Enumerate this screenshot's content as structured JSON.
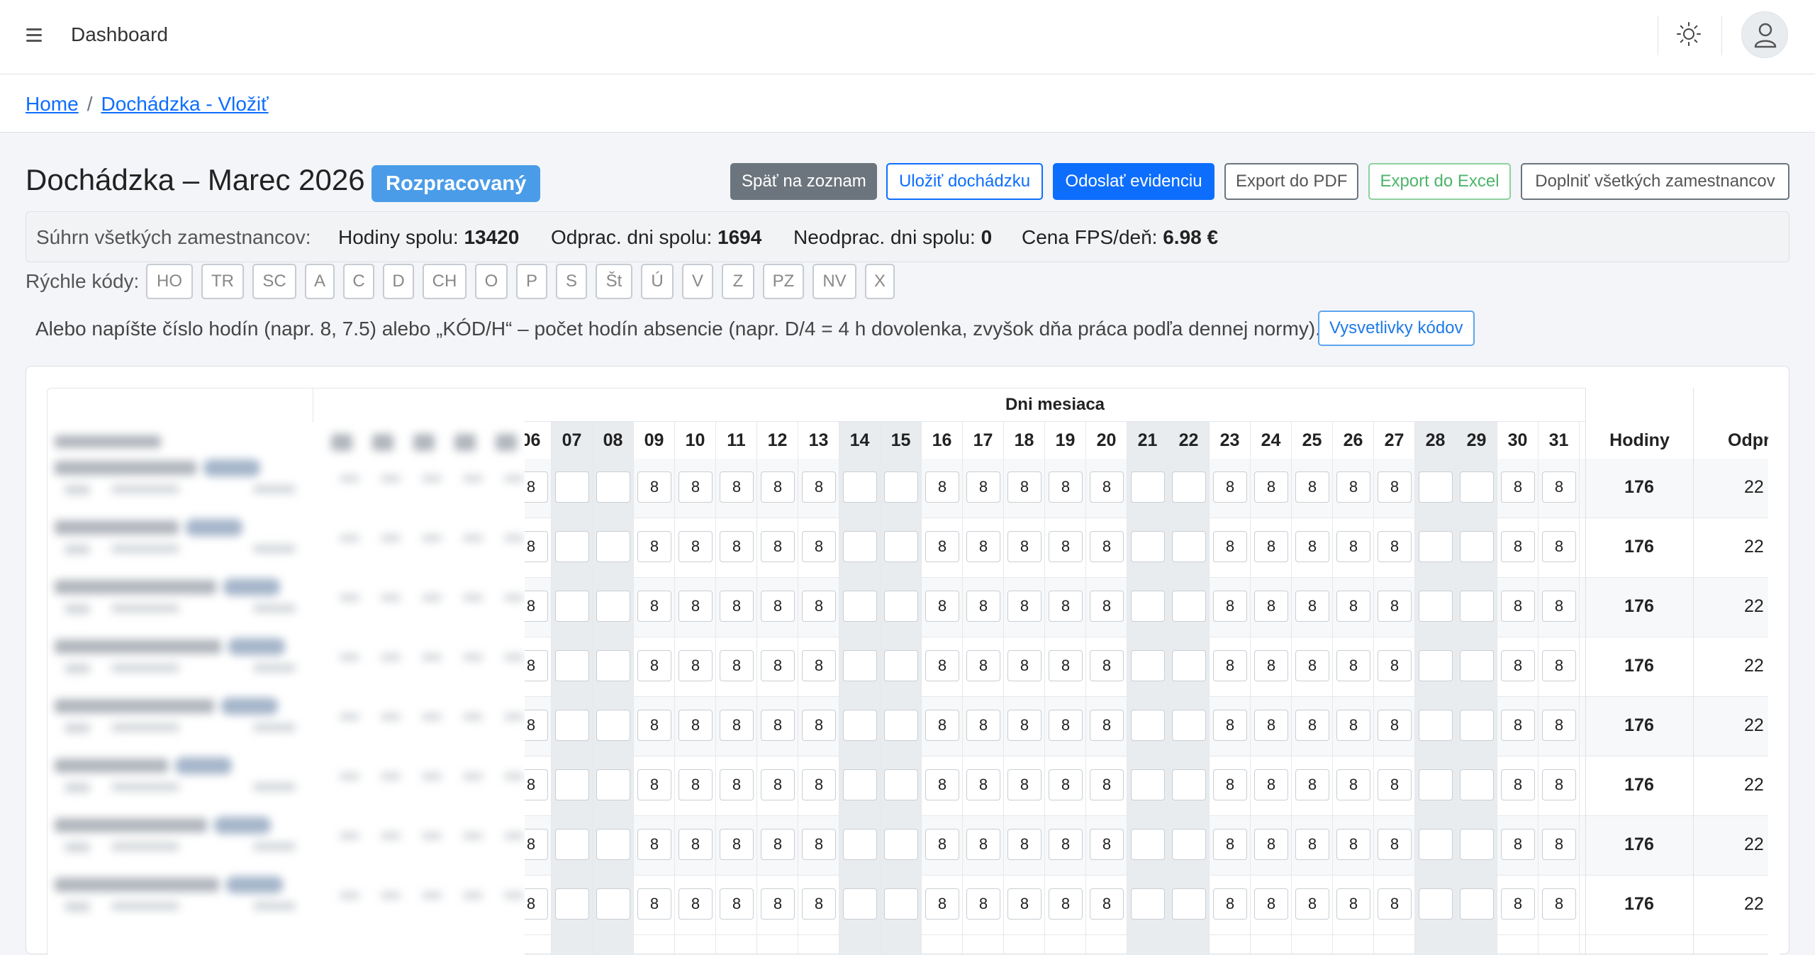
{
  "header": {
    "title": "Dashboard"
  },
  "breadcrumb": {
    "home": "Home",
    "current": "Dochádzka - Vložiť",
    "separator": "/"
  },
  "page": {
    "title": "Dochádzka – Marec 2026",
    "status": "Rozpracovaný",
    "buttons": {
      "back": "Späť na zoznam",
      "save": "Uložiť dochádzku",
      "send": "Odoslať evidenciu",
      "export_pdf": "Export do PDF",
      "export_excel": "Export do Excel",
      "fill_all": "Doplniť všetkých zamestnancov"
    }
  },
  "summary": {
    "label": "Súhrn všetkých zamestnancov:",
    "hours_label": "Hodiny spolu:",
    "hours_value": "13420",
    "worked_label": "Odprac. dni spolu:",
    "worked_value": "1694",
    "notworked_label": "Neodprac. dni spolu:",
    "notworked_value": "0",
    "price_label": "Cena FPS/deň:",
    "price_value": "6.98 €"
  },
  "quick_codes": {
    "label": "Rýchle kódy:",
    "codes": [
      "HO",
      "TR",
      "SC",
      "A",
      "C",
      "D",
      "CH",
      "O",
      "P",
      "S",
      "Št",
      "Ú",
      "V",
      "Z",
      "PZ",
      "NV",
      "X"
    ]
  },
  "hint": {
    "text": "Alebo napíšte číslo hodín (napr. 8, 7.5) alebo „KÓD/H“ – počet hodín absencie (napr. D/4 = 4 h dovolenka, zvyšok dňa práca podľa dennej normy).",
    "explain_button": "Vysvetlivky kódov"
  },
  "table": {
    "days_header": "Dni mesiaca",
    "days": [
      "06",
      "07",
      "08",
      "09",
      "10",
      "11",
      "12",
      "13",
      "14",
      "15",
      "16",
      "17",
      "18",
      "19",
      "20",
      "21",
      "22",
      "23",
      "24",
      "25",
      "26",
      "27",
      "28",
      "29",
      "30",
      "31"
    ],
    "weekend_days": [
      "07",
      "08",
      "14",
      "15",
      "21",
      "22",
      "28",
      "29"
    ],
    "columns": {
      "hours": "Hodiny",
      "worked": "Odprac"
    },
    "cell_value": "8",
    "rows": [
      {
        "hours": "176",
        "worked": "22"
      },
      {
        "hours": "176",
        "worked": "22"
      },
      {
        "hours": "176",
        "worked": "22"
      },
      {
        "hours": "176",
        "worked": "22"
      },
      {
        "hours": "176",
        "worked": "22"
      },
      {
        "hours": "176",
        "worked": "22"
      },
      {
        "hours": "176",
        "worked": "22"
      },
      {
        "hours": "176",
        "worked": "22"
      }
    ]
  },
  "icons": {
    "menu": "hamburger-icon",
    "theme": "sun-icon",
    "user": "user-icon"
  }
}
